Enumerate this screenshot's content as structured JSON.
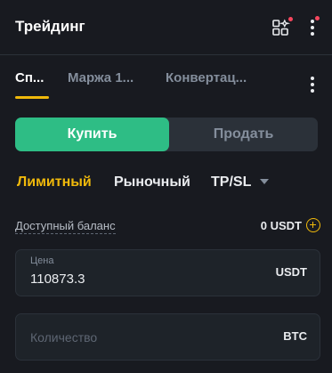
{
  "header": {
    "title": "Трейдинг",
    "icons": [
      "grid-apps-icon",
      "more-vertical-icon"
    ],
    "notification_color": "#f6465d"
  },
  "tabs": [
    {
      "label": "Сп...",
      "active": true
    },
    {
      "label": "Маржа 1...",
      "active": false
    },
    {
      "label": "Конвертац...",
      "active": false
    }
  ],
  "side": {
    "buy_label": "Купить",
    "sell_label": "Продать",
    "selected": "buy",
    "buy_color": "#2ebd85"
  },
  "order_types": {
    "limit": "Лимитный",
    "market": "Рыночный",
    "tpsl": "TP/SL",
    "selected": "limit",
    "accent": "#f0b90b"
  },
  "balance": {
    "label": "Доступный баланс",
    "value": "0 USDT"
  },
  "price": {
    "caption": "Цена",
    "value": "110873.3",
    "unit": "USDT"
  },
  "quantity": {
    "placeholder": "Количество",
    "unit": "BTC"
  }
}
